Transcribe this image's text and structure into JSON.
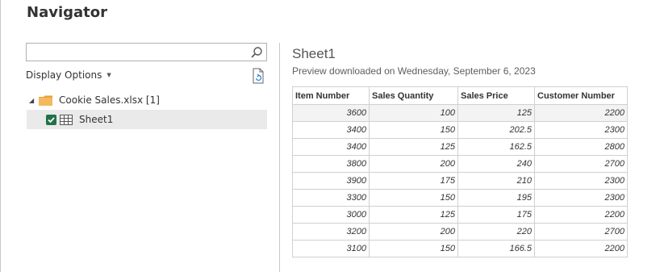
{
  "title": "Navigator",
  "search": {
    "value": "",
    "placeholder": ""
  },
  "display_options": {
    "label": "Display Options"
  },
  "tree": {
    "parent": {
      "label": "Cookie Sales.xlsx [1]",
      "icon": "folder-icon"
    },
    "children": [
      {
        "label": "Sheet1",
        "checked": true,
        "icon": "table-icon"
      }
    ]
  },
  "preview": {
    "title": "Sheet1",
    "subtitle": "Preview downloaded on Wednesday, September 6, 2023",
    "columns": [
      "Item Number",
      "Sales Quantity",
      "Sales Price",
      "Customer Number"
    ],
    "rows": [
      [
        "3600",
        "100",
        "125",
        "2200"
      ],
      [
        "3400",
        "150",
        "202.5",
        "2300"
      ],
      [
        "3400",
        "125",
        "162.5",
        "2800"
      ],
      [
        "3800",
        "200",
        "240",
        "2700"
      ],
      [
        "3900",
        "175",
        "210",
        "2300"
      ],
      [
        "3300",
        "150",
        "195",
        "2300"
      ],
      [
        "3000",
        "125",
        "175",
        "2200"
      ],
      [
        "3200",
        "200",
        "220",
        "2700"
      ],
      [
        "3100",
        "150",
        "166.5",
        "2200"
      ]
    ]
  },
  "colors": {
    "accent": "#217346",
    "folder": "#e8a33c",
    "selection": "#eaeaea"
  }
}
